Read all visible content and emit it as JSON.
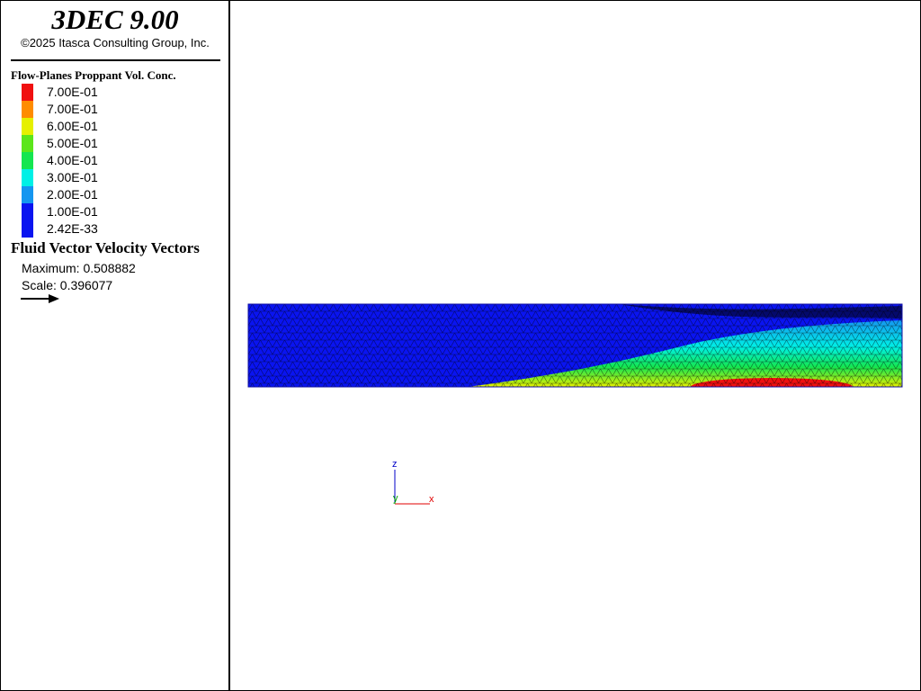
{
  "app": {
    "title": "3DEC 9.00",
    "copyright": "©2025 Itasca Consulting Group, Inc."
  },
  "legend": {
    "plot_title": "Flow-Planes Proppant Vol. Conc.",
    "scale": [
      {
        "label": "7.00E-01",
        "color": "#f01010"
      },
      {
        "label": "7.00E-01",
        "color": "#ff8c00"
      },
      {
        "label": "6.00E-01",
        "color": "#e6f000"
      },
      {
        "label": "5.00E-01",
        "color": "#5ce61a"
      },
      {
        "label": "4.00E-01",
        "color": "#14e650"
      },
      {
        "label": "3.00E-01",
        "color": "#00f0e6"
      },
      {
        "label": "2.00E-01",
        "color": "#1496f0"
      },
      {
        "label": "1.00E-01",
        "color": "#0a14f0"
      },
      {
        "label": "2.42E-33",
        "color": "#0a14f0"
      }
    ],
    "vectors": {
      "title": "Fluid Vector Velocity Vectors",
      "maximum": "Maximum: 0.508882",
      "scale": "Scale: 0.396077"
    }
  },
  "axes": {
    "z": "z",
    "y": "y",
    "x": "x",
    "z_color": "#0000c8",
    "y_color": "#00a000",
    "x_color": "#e00000"
  }
}
